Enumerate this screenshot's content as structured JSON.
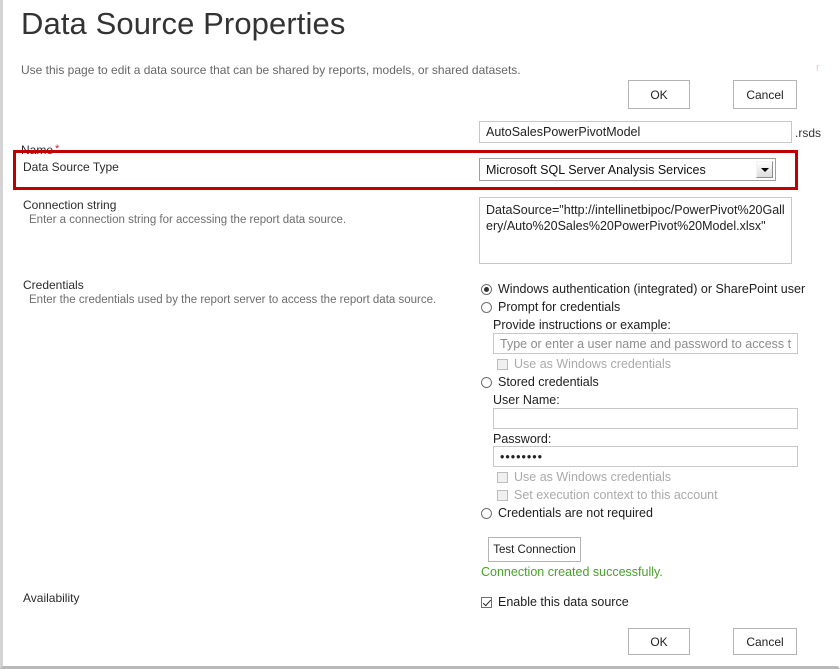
{
  "header": {
    "title": "Data Source Properties",
    "intro": "Use this page to edit a data source that can be shared by reports, models, or shared datasets.",
    "edge_artifact": "r"
  },
  "top_actions": {
    "ok_label": "OK",
    "cancel_label": "Cancel"
  },
  "bottom_actions": {
    "ok_label": "OK",
    "cancel_label": "Cancel"
  },
  "name_field": {
    "label": "Name",
    "required_marker": "*",
    "value": "AutoSalesPowerPivotModel",
    "suffix": ".rsds"
  },
  "data_source_type": {
    "label": "Data Source Type",
    "selected": "Microsoft SQL Server Analysis Services"
  },
  "connection_string": {
    "label": "Connection string",
    "description": "Enter a connection string for accessing the report data source.",
    "value": "DataSource=\"http://intellinetbipoc/PowerPivot%20Gallery/Auto%20Sales%20PowerPivot%20Model.xlsx\""
  },
  "credentials": {
    "label": "Credentials",
    "description": "Enter the credentials used by the report server to access the report data source.",
    "option_windows_auth": "Windows authentication (integrated) or SharePoint user",
    "option_prompt": "Prompt for credentials",
    "prompt_instructions_label": "Provide instructions or example:",
    "prompt_instructions_placeholder": "Type or enter a user name and password to access the data source",
    "prompt_use_windows_credentials": "Use as Windows credentials",
    "option_stored": "Stored credentials",
    "user_name_label": "User Name:",
    "user_name_value": "",
    "password_label": "Password:",
    "password_value": "••••••••",
    "stored_use_windows_credentials": "Use as Windows credentials",
    "stored_set_execution_context": "Set execution context to this account",
    "option_not_required": "Credentials are not required"
  },
  "test_connection": {
    "button_label": "Test Connection",
    "status_message": "Connection created successfully."
  },
  "availability": {
    "label": "Availability",
    "enable_checkbox_label": "Enable this data source"
  },
  "colors": {
    "annotation": "#c00000",
    "success": "#4aa02c",
    "required": "#cc2222"
  }
}
